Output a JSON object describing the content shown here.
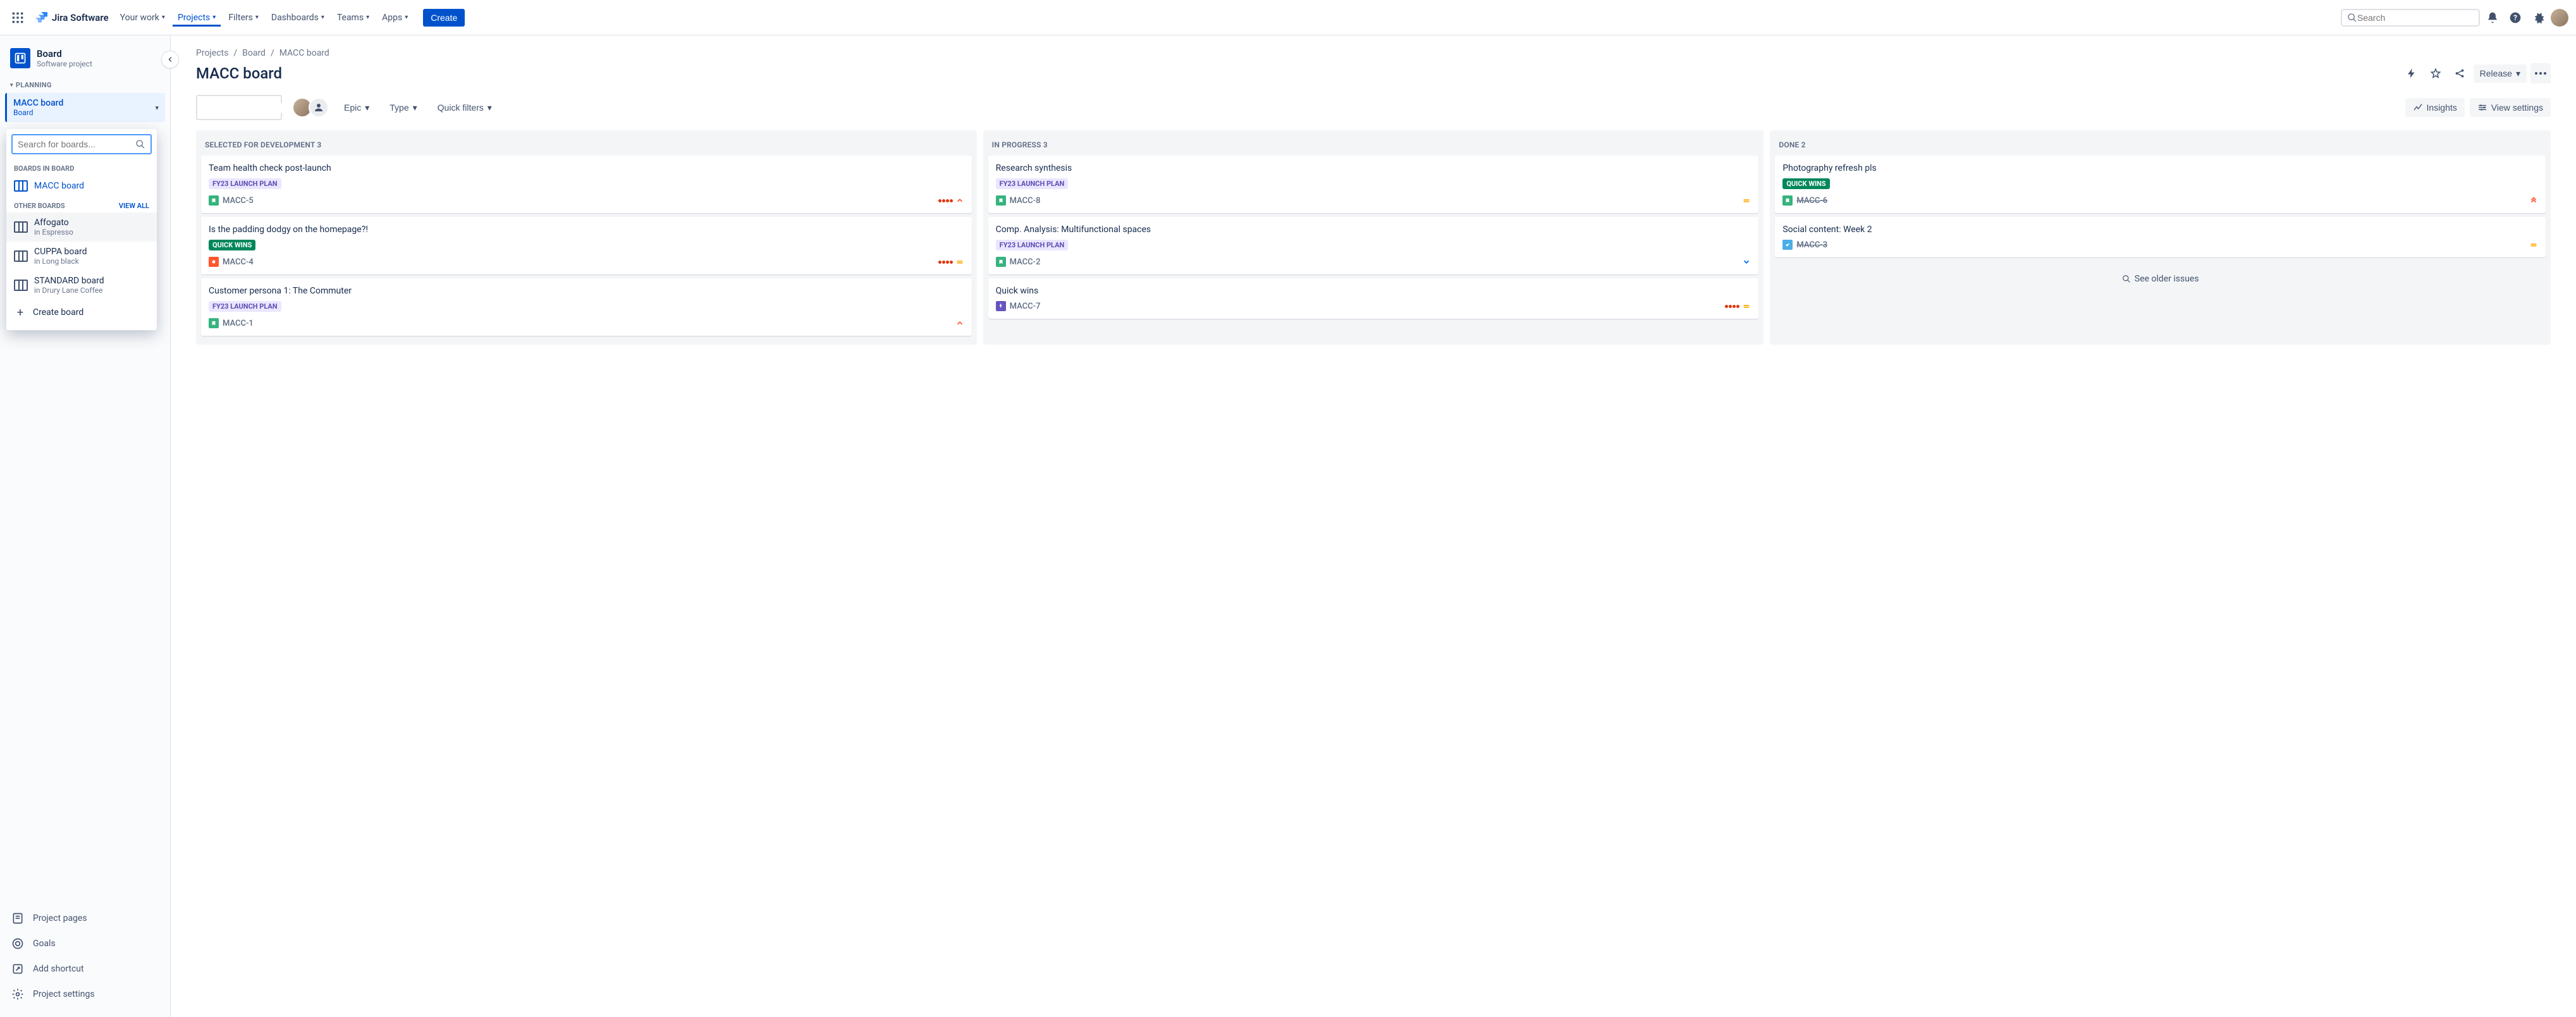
{
  "nav": {
    "logo_text": "Jira Software",
    "items": [
      "Your work",
      "Projects",
      "Filters",
      "Dashboards",
      "Teams",
      "Apps"
    ],
    "active_index": 1,
    "create": "Create",
    "search_placeholder": "Search"
  },
  "sidebar": {
    "project_name": "Board",
    "project_type": "Software project",
    "section_planning": "PLANNING",
    "board_picker": {
      "name": "MACC board",
      "sub": "Board"
    },
    "dropdown": {
      "search_placeholder": "Search for boards...",
      "section_boards": "BOARDS IN BOARD",
      "current_board": "MACC board",
      "section_other": "OTHER BOARDS",
      "view_all": "VIEW ALL",
      "other_boards": [
        {
          "name": "Affogato",
          "project": "in Espresso"
        },
        {
          "name": "CUPPA board",
          "project": "in Long black"
        },
        {
          "name": "STANDARD board",
          "project": "in Drury Lane Coffee"
        }
      ],
      "create_board": "Create board"
    },
    "links": {
      "pages": "Project pages",
      "goals": "Goals",
      "shortcut": "Add shortcut",
      "settings": "Project settings"
    }
  },
  "breadcrumb": [
    "Projects",
    "Board",
    "MACC board"
  ],
  "page_title": "MACC board",
  "header_actions": {
    "release": "Release"
  },
  "controls": {
    "filters": [
      "Epic",
      "Type",
      "Quick filters"
    ],
    "insights": "Insights",
    "view_settings": "View settings"
  },
  "columns": [
    {
      "title": "SELECTED FOR DEVELOPMENT",
      "count": 3,
      "cards": [
        {
          "title": "Team health check post-launch",
          "tag": "FY23 LAUNCH PLAN",
          "tag_style": "purple",
          "type": "story",
          "key": "MACC-5",
          "dots": 4,
          "prio": "high-red"
        },
        {
          "title": "Is the padding dodgy on the homepage?!",
          "tag": "QUICK WINS",
          "tag_style": "teal",
          "type": "bug",
          "key": "MACC-4",
          "dots": 4,
          "prio": "medium"
        },
        {
          "title": "Customer persona 1: The Commuter",
          "tag": "FY23 LAUNCH PLAN",
          "tag_style": "purple",
          "type": "story",
          "key": "MACC-1",
          "prio": "high-red"
        }
      ]
    },
    {
      "title": "IN PROGRESS",
      "count": 3,
      "cards": [
        {
          "title": "Research synthesis",
          "tag": "FY23 LAUNCH PLAN",
          "tag_style": "purple",
          "type": "story",
          "key": "MACC-8",
          "prio": "medium"
        },
        {
          "title": "Comp. Analysis: Multifunctional spaces",
          "tag": "FY23 LAUNCH PLAN",
          "tag_style": "purple",
          "type": "story",
          "key": "MACC-2",
          "prio": "low"
        },
        {
          "title": "Quick wins",
          "type": "epic",
          "key": "MACC-7",
          "dots": 4,
          "prio": "medium"
        }
      ]
    },
    {
      "title": "DONE",
      "count": 2,
      "cards": [
        {
          "title": "Photography refresh pls",
          "tag": "QUICK WINS",
          "tag_style": "teal",
          "type": "story",
          "key": "MACC-6",
          "strike": true,
          "prio": "highest"
        },
        {
          "title": "Social content: Week 2",
          "type": "task",
          "key": "MACC-3",
          "strike": true,
          "prio": "medium"
        }
      ],
      "see_older": "See older issues"
    }
  ]
}
